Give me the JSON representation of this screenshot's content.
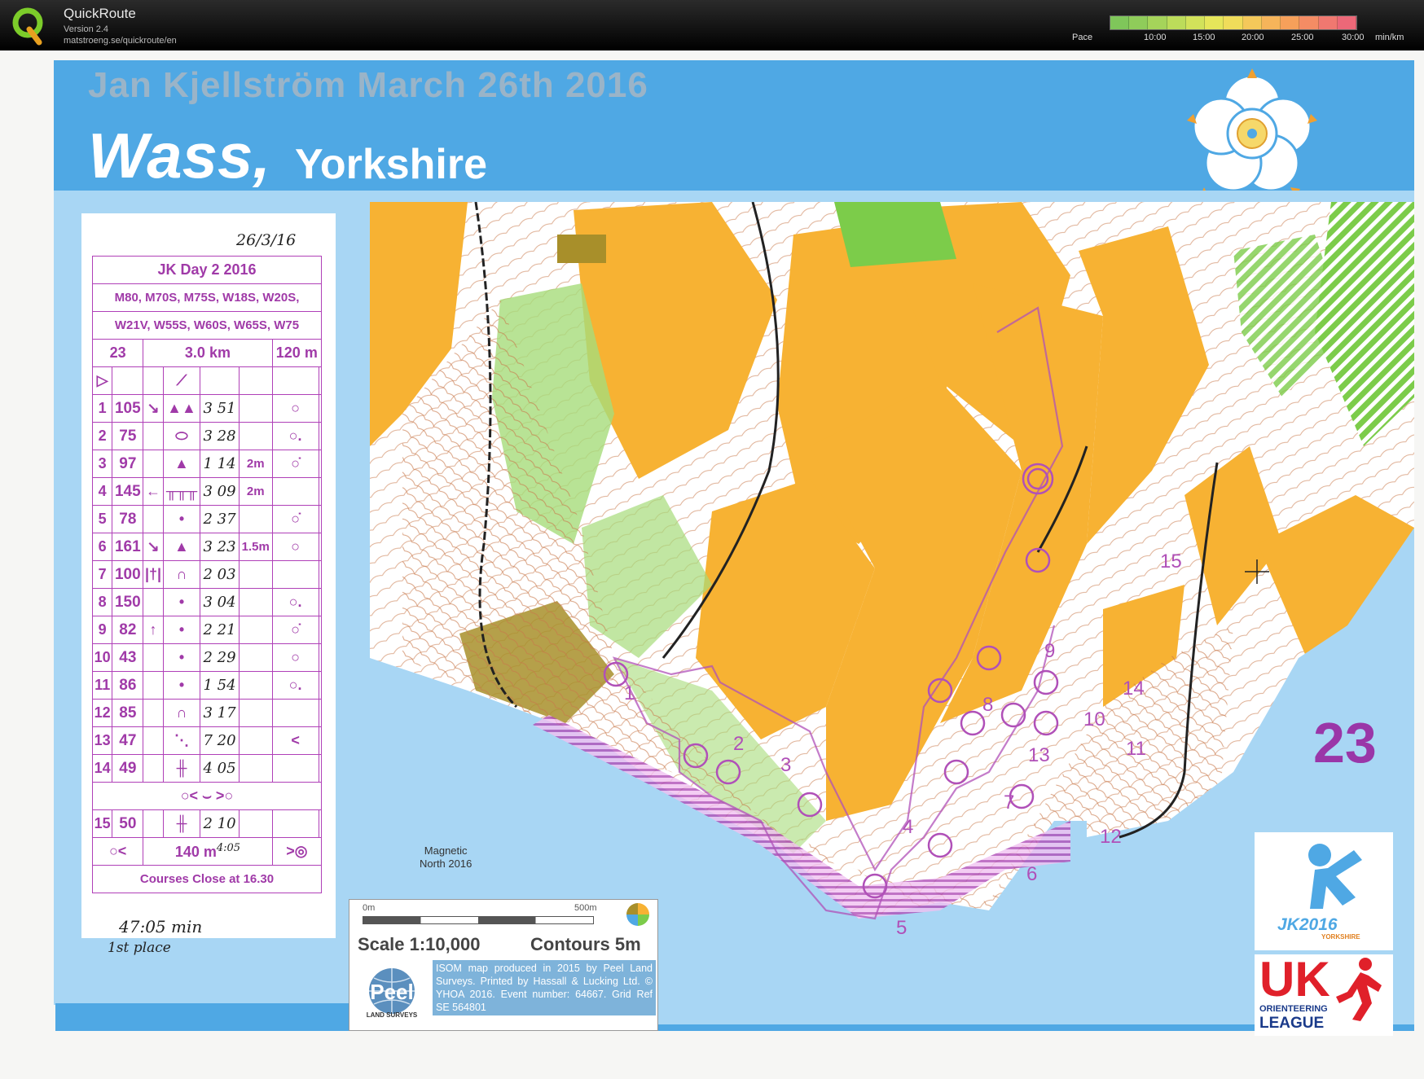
{
  "app": {
    "name": "QuickRoute",
    "version": "Version 2.4",
    "url": "matstroeng.se/quickroute/en"
  },
  "pace_legend": {
    "label": "Pace",
    "ticks": [
      "10:00",
      "15:00",
      "20:00",
      "25:00",
      "30:00"
    ],
    "unit": "min/km",
    "colors": [
      "#7fc65a",
      "#8fcc5a",
      "#a5d45a",
      "#bcdc5a",
      "#d2e25a",
      "#e6e65a",
      "#f0dc5a",
      "#f4c85a",
      "#f6b45a",
      "#f6a05a",
      "#f48c64",
      "#f07870",
      "#ec6878"
    ]
  },
  "map": {
    "event_title": "Jan Kjellström March 26th 2016",
    "venue": "Wass,",
    "region": "Yorkshire",
    "course_number": "23",
    "magnetic_north": [
      "Magnetic",
      "North 2016"
    ],
    "scale_bar": {
      "start": "0m",
      "end": "500m"
    },
    "scale": "Scale 1:10,000",
    "contours": "Contours 5m",
    "credits": "ISOM map produced in 2015 by Peel Land Surveys. Printed by Hassall & Lucking Ltd. © YHOA 2016. Event number: 64667. Grid Ref SE 564801",
    "peel_logo": {
      "text": "Peel",
      "sub": "LAND SURVEYS"
    },
    "jk_logo": {
      "text": "JK2016",
      "sub": "YORKSHIRE"
    },
    "league_logo": {
      "text": "UK",
      "sub1": "ORIENTEERING",
      "sub2": "LEAGUE"
    },
    "colors": {
      "open_land": "#f7b233",
      "forest": "#ffffff",
      "green": "#7ccc4a",
      "water": "#a8d6f4",
      "purple": "#b050b8",
      "header_blue": "#4fa8e4"
    }
  },
  "control_card": {
    "date_handwritten": "26/3/16",
    "title": "JK Day 2 2016",
    "classes_1": "M80, M70S, M75S, W18S, W20S,",
    "classes_2": "W21V, W55S, W60S, W65S, W75",
    "course": "23",
    "length": "3.0 km",
    "climb": "120 m",
    "controls": [
      {
        "num": "1",
        "code": "105",
        "dir": "↘",
        "feature": "▲▲",
        "split": "3 51",
        "dim": "",
        "loc": "○"
      },
      {
        "num": "2",
        "code": "75",
        "dir": "",
        "feature": "⬭",
        "split": "3 28",
        "dim": "",
        "loc": "○."
      },
      {
        "num": "3",
        "code": "97",
        "dir": "",
        "feature": "▲",
        "split": "1 14",
        "dim": "2m",
        "loc": "○̇"
      },
      {
        "num": "4",
        "code": "145",
        "dir": "←",
        "feature": "╥╥╥",
        "split": "3 09",
        "dim": "2m",
        "loc": ""
      },
      {
        "num": "5",
        "code": "78",
        "dir": "",
        "feature": "•",
        "split": "2 37",
        "dim": "",
        "loc": "○̇"
      },
      {
        "num": "6",
        "code": "161",
        "dir": "↘",
        "feature": "▲",
        "split": "3 23",
        "dim": "1.5m",
        "loc": "○"
      },
      {
        "num": "7",
        "code": "100",
        "dir": "|†|",
        "feature": "∩",
        "split": "2 03",
        "dim": "",
        "loc": ""
      },
      {
        "num": "8",
        "code": "150",
        "dir": "",
        "feature": "•",
        "split": "3 04",
        "dim": "",
        "loc": "○."
      },
      {
        "num": "9",
        "code": "82",
        "dir": "↑",
        "feature": "•",
        "split": "2 21",
        "dim": "",
        "loc": "○̇"
      },
      {
        "num": "10",
        "code": "43",
        "dir": "",
        "feature": "•",
        "split": "2 29",
        "dim": "",
        "loc": "○"
      },
      {
        "num": "11",
        "code": "86",
        "dir": "",
        "feature": "•",
        "split": "1 54",
        "dim": "",
        "loc": "○."
      },
      {
        "num": "12",
        "code": "85",
        "dir": "",
        "feature": "∩",
        "split": "3 17",
        "dim": "",
        "loc": ""
      },
      {
        "num": "13",
        "code": "47",
        "dir": "",
        "feature": "⋱",
        "split": "7 20",
        "dim": "",
        "loc": "<"
      },
      {
        "num": "14",
        "code": "49",
        "dir": "",
        "feature": "╫",
        "split": "4 05",
        "dim": "",
        "loc": ""
      },
      {
        "num": "15",
        "code": "50",
        "dir": "",
        "feature": "╫",
        "split": "2 10",
        "dim": "",
        "loc": ""
      }
    ],
    "taped_route_1": "○< ⌣ >○",
    "finish_distance": "140 m",
    "finish_split": "4:05",
    "closing": "Courses Close at 16.30",
    "result_time": "47:05 min",
    "result_place": "1st place"
  }
}
